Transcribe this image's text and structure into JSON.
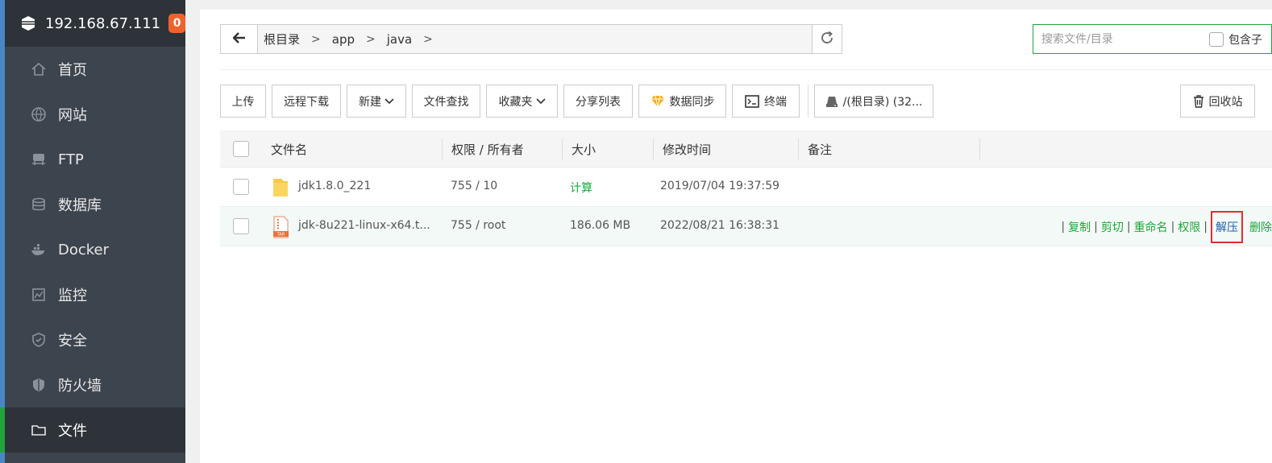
{
  "sidebar": {
    "server_ip": "192.168.67.111",
    "badge_count": "0",
    "items": [
      {
        "label": "首页",
        "icon": "home-icon"
      },
      {
        "label": "网站",
        "icon": "globe-icon"
      },
      {
        "label": "FTP",
        "icon": "ftp-icon"
      },
      {
        "label": "数据库",
        "icon": "database-icon"
      },
      {
        "label": "Docker",
        "icon": "docker-icon"
      },
      {
        "label": "监控",
        "icon": "monitor-icon"
      },
      {
        "label": "安全",
        "icon": "shield-icon"
      },
      {
        "label": "防火墙",
        "icon": "firewall-icon"
      },
      {
        "label": "文件",
        "icon": "folder-icon",
        "active": true
      }
    ]
  },
  "path": {
    "crumbs": [
      "根目录",
      "app",
      "java"
    ]
  },
  "search": {
    "placeholder": "搜索文件/目录",
    "include_sub_label": "包含子"
  },
  "toolbar": {
    "upload": "上传",
    "remote_download": "远程下载",
    "new": "新建",
    "find_file": "文件查找",
    "favorites": "收藏夹",
    "share_list": "分享列表",
    "data_sync": "数据同步",
    "terminal": "终端",
    "disk": "/(根目录) (32...",
    "recycle_bin": "回收站"
  },
  "table": {
    "headers": {
      "name": "文件名",
      "perm_owner": "权限 / 所有者",
      "size": "大小",
      "mtime": "修改时间",
      "note": "备注"
    },
    "rows": [
      {
        "name": "jdk1.8.0_221",
        "perm": "755 / 10",
        "size": "计算",
        "mtime": "2019/07/04 19:37:59",
        "type": "folder"
      },
      {
        "name": "jdk-8u221-linux-x64.t...",
        "perm": "755 / root",
        "size": "186.06 MB",
        "mtime": "2022/08/21 16:38:31",
        "type": "tar"
      }
    ],
    "ops": {
      "copy": "复制",
      "cut": "剪切",
      "rename": "重命名",
      "permission": "权限",
      "extract": "解压",
      "delete": "删除"
    }
  },
  "colors": {
    "accent_green": "#20a53a",
    "sidebar_bg": "#3c444d",
    "badge_orange": "#f0622b",
    "highlight_red": "#e02f2f"
  }
}
